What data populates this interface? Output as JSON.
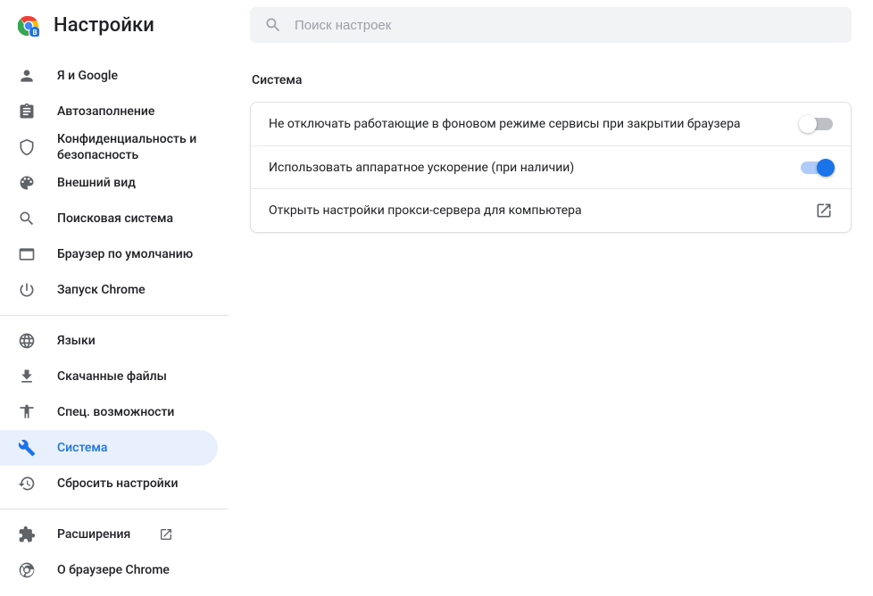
{
  "app": {
    "title": "Настройки"
  },
  "search": {
    "placeholder": "Поиск настроек"
  },
  "sidebar": {
    "group1": [
      {
        "label": "Я и Google"
      },
      {
        "label": "Автозаполнение"
      },
      {
        "label": "Конфиденциальность и безопасность"
      },
      {
        "label": "Внешний вид"
      },
      {
        "label": "Поисковая система"
      },
      {
        "label": "Браузер по умолчанию"
      },
      {
        "label": "Запуск Chrome"
      }
    ],
    "group2": [
      {
        "label": "Языки"
      },
      {
        "label": "Скачанные файлы"
      },
      {
        "label": "Спец. возможности"
      },
      {
        "label": "Система"
      },
      {
        "label": "Сбросить настройки"
      }
    ],
    "group3": [
      {
        "label": "Расширения"
      },
      {
        "label": "О браузере Chrome"
      }
    ]
  },
  "section": {
    "title": "Система",
    "rows": [
      {
        "label": "Не отключать работающие в фоновом режиме сервисы при закрытии браузера",
        "toggle": false
      },
      {
        "label": "Использовать аппаратное ускорение (при наличии)",
        "toggle": true
      },
      {
        "label": "Открыть настройки прокси-сервера для компьютера"
      }
    ]
  }
}
